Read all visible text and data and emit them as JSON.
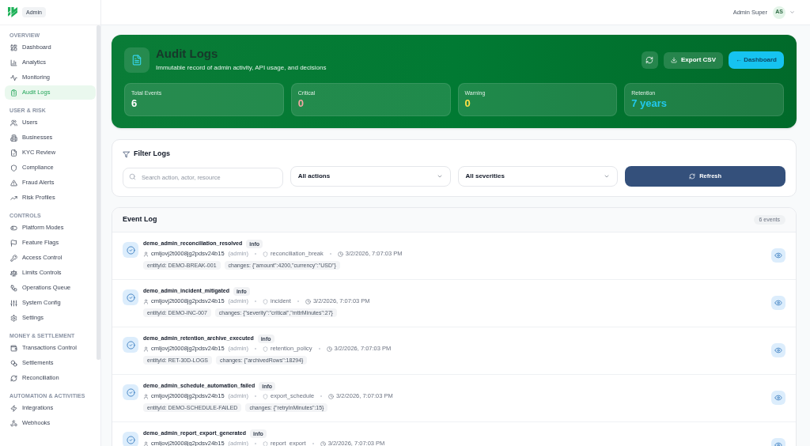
{
  "sidebar": {
    "badge": "Admin",
    "sections": [
      {
        "title": "OVERVIEW",
        "items": [
          {
            "label": "Dashboard",
            "selected": false
          },
          {
            "label": "Analytics",
            "selected": false
          },
          {
            "label": "Monitoring",
            "selected": false
          },
          {
            "label": "Audit Logs",
            "selected": true
          }
        ]
      },
      {
        "title": "USER & RISK",
        "items": [
          {
            "label": "Users",
            "selected": false
          },
          {
            "label": "Businesses",
            "selected": false
          },
          {
            "label": "KYC Review",
            "selected": false
          },
          {
            "label": "Compliance",
            "selected": false
          },
          {
            "label": "Fraud Alerts",
            "selected": false
          },
          {
            "label": "Risk Profiles",
            "selected": false
          }
        ]
      },
      {
        "title": "CONTROLS",
        "items": [
          {
            "label": "Platform Modes",
            "selected": false
          },
          {
            "label": "Feature Flags",
            "selected": false
          },
          {
            "label": "Access Control",
            "selected": false
          },
          {
            "label": "Limits Controls",
            "selected": false
          },
          {
            "label": "Operations Queue",
            "selected": false
          },
          {
            "label": "System Config",
            "selected": false
          },
          {
            "label": "Settings",
            "selected": false
          }
        ]
      },
      {
        "title": "MONEY & SETTLEMENT",
        "items": [
          {
            "label": "Transactions Control",
            "selected": false
          },
          {
            "label": "Settlements",
            "selected": false
          },
          {
            "label": "Reconciliation",
            "selected": false
          }
        ]
      },
      {
        "title": "AUTOMATION & ACTIVITIES",
        "items": [
          {
            "label": "Integrations",
            "selected": false
          },
          {
            "label": "Webhooks",
            "selected": false
          }
        ]
      }
    ]
  },
  "top_bar": {
    "user_name": "Admin Super",
    "avatar_initials": "AS"
  },
  "header": {
    "title": "Audit Logs",
    "subtitle": "Immutable record of admin activity, API usage, and decisions",
    "buttons": [
      {
        "kind": "icon"
      },
      {
        "kind": "secondary",
        "label": "Export CSV"
      },
      {
        "kind": "primary",
        "label": "← Dashboard"
      }
    ],
    "stats": [
      {
        "label": "Total Events",
        "value": "6",
        "color": "#ffffff"
      },
      {
        "label": "Critical",
        "value": "0",
        "color": "#f4a7a3"
      },
      {
        "label": "Warning",
        "value": "0",
        "color": "#fde047"
      },
      {
        "label": "Retention",
        "value": "7 years",
        "color": "#22c8ec"
      }
    ]
  },
  "filters": {
    "title": "Filter Logs",
    "search": {
      "placeholder": "Search action, actor, resource"
    },
    "selects": [
      {
        "value": "All actions"
      },
      {
        "value": "All severities"
      }
    ],
    "refresh_button": "Refresh"
  },
  "event_log": {
    "title": "Event Log",
    "count": "6 events",
    "events": [
      {
        "action": "demo_admin_reconciliation_resolved",
        "severity": "info",
        "actor": "cmljovj2t0008jg2pdsv24b15",
        "role": "(admin)",
        "resource": "reconciliation_break",
        "time": "3/2/2026, 7:07:03 PM",
        "details": [
          "entityId: DEMO-BREAK-001",
          "changes: {\"amount\":4200,\"currency\":\"USD\"}"
        ]
      },
      {
        "action": "demo_admin_incident_mitigated",
        "severity": "info",
        "actor": "cmljovj2t0008jg2pdsv24b15",
        "role": "(admin)",
        "resource": "incident",
        "time": "3/2/2026, 7:07:03 PM",
        "details": [
          "entityId: DEMO-INC-007",
          "changes: {\"severity\":\"critical\",\"mttrMinutes\":27}"
        ]
      },
      {
        "action": "demo_admin_retention_archive_executed",
        "severity": "info",
        "actor": "cmljovj2t0008jg2pdsv24b15",
        "role": "(admin)",
        "resource": "retention_policy",
        "time": "3/2/2026, 7:07:03 PM",
        "details": [
          "entityId: RET-30D-LOGS",
          "changes: {\"archivedRows\":18294}"
        ]
      },
      {
        "action": "demo_admin_schedule_automation_failed",
        "severity": "info",
        "actor": "cmljovj2t0008jg2pdsv24b15",
        "role": "(admin)",
        "resource": "export_schedule",
        "time": "3/2/2026, 7:07:03 PM",
        "details": [
          "entityId: DEMO-SCHEDULE-FAILED",
          "changes: {\"retryInMinutes\":15}"
        ]
      },
      {
        "action": "demo_admin_report_export_generated",
        "severity": "info",
        "actor": "cmljovj2t0008jg2pdsv24b15",
        "role": "(admin)",
        "resource": "report_export",
        "time": "3/2/2026, 7:07:03 PM"
      }
    ]
  }
}
